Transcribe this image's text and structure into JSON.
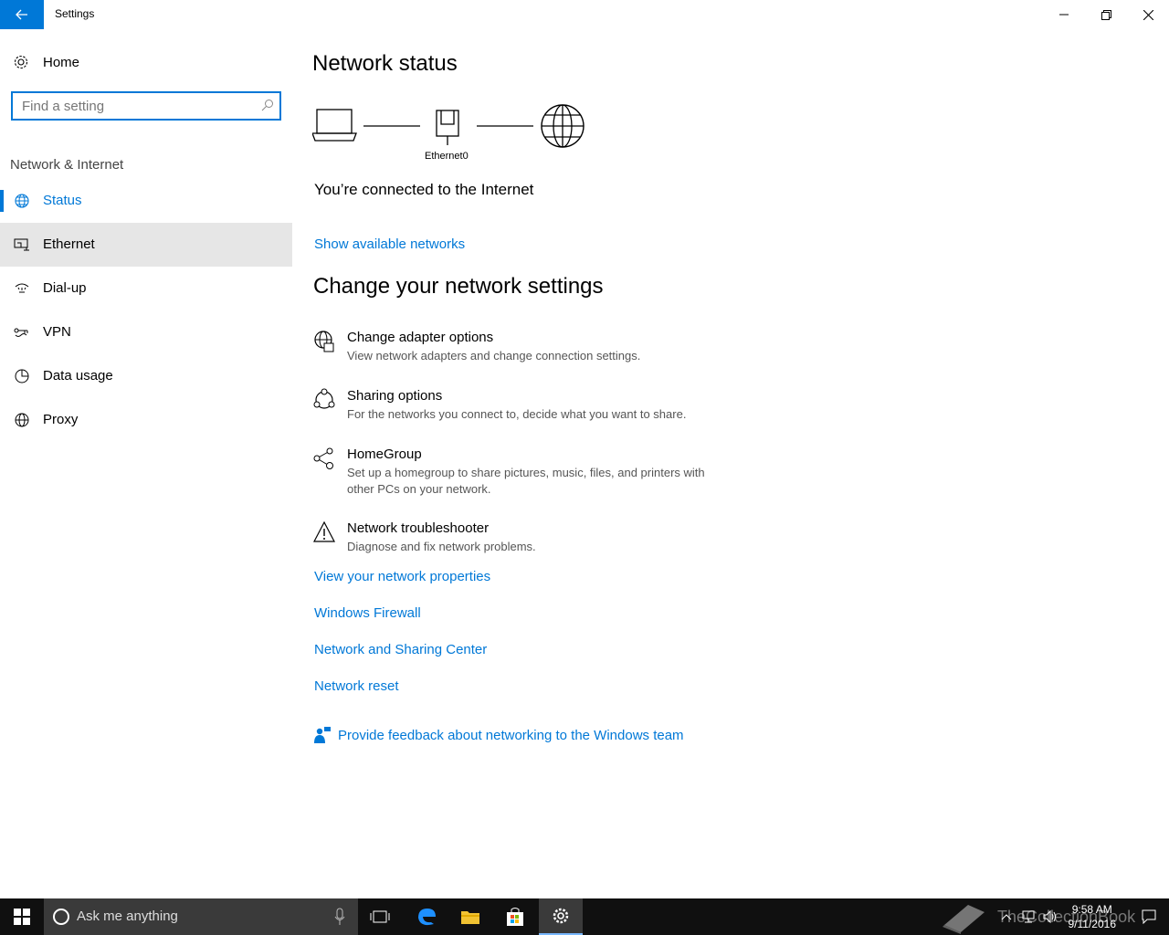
{
  "window": {
    "title": "Settings"
  },
  "sidebar": {
    "home_label": "Home",
    "search_placeholder": "Find a setting",
    "section_heading": "Network & Internet",
    "items": [
      {
        "label": "Status",
        "icon": "globe-status-icon"
      },
      {
        "label": "Ethernet",
        "icon": "ethernet-icon"
      },
      {
        "label": "Dial-up",
        "icon": "dialup-icon"
      },
      {
        "label": "VPN",
        "icon": "vpn-icon"
      },
      {
        "label": "Data usage",
        "icon": "pie-chart-icon"
      },
      {
        "label": "Proxy",
        "icon": "globe-icon"
      }
    ]
  },
  "main": {
    "status_heading": "Network status",
    "adapter_name": "Ethernet0",
    "connection_status": "You’re connected to the Internet",
    "show_networks_link": "Show available networks",
    "change_heading": "Change your network settings",
    "options": [
      {
        "title": "Change adapter options",
        "desc": "View network adapters and change connection settings.",
        "icon": "adapter-globe-icon"
      },
      {
        "title": "Sharing options",
        "desc": "For the networks you connect to, decide what you want to share.",
        "icon": "sharing-icon"
      },
      {
        "title": "HomeGroup",
        "desc": "Set up a homegroup to share pictures, music, files, and printers with other PCs on your network.",
        "icon": "homegroup-icon"
      },
      {
        "title": "Network troubleshooter",
        "desc": "Diagnose and fix network problems.",
        "icon": "warning-icon"
      }
    ],
    "links": {
      "properties": "View your network properties",
      "firewall": "Windows Firewall",
      "sharing_center": "Network and Sharing Center",
      "reset": "Network reset"
    },
    "feedback_label": "Provide feedback about networking to the Windows team"
  },
  "taskbar": {
    "search_placeholder": "Ask me anything",
    "time": "9:58 AM",
    "date": "9/11/2016",
    "watermark": "TheCollectionBook"
  },
  "colors": {
    "accent": "#0078d7",
    "taskbar": "#101010"
  }
}
